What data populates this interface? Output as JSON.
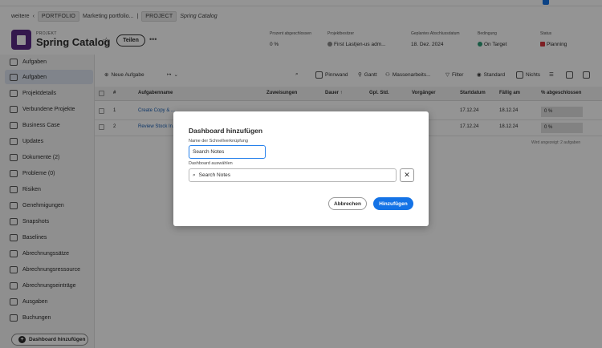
{
  "breadcrumb": {
    "back": "weitere",
    "portfolio_type": "PORTFOLIO",
    "portfolio_name": "Marketing portfolio...",
    "sep": "|",
    "project_type": "PROJECT",
    "project_name": "Spring Catalog"
  },
  "header": {
    "type_label": "PROJEKT",
    "title": "Spring Catalog",
    "share_label": "Teilen",
    "more_label": "•••",
    "meta": [
      {
        "label": "Prozent abgeschlossen",
        "value": "0 %"
      },
      {
        "label": "Projektbesitzer",
        "value": "First Last|en-us adm..."
      },
      {
        "label": "Geplantes Abschlussdatum",
        "value": "18. Dez. 2024"
      },
      {
        "label": "Bedingung",
        "value": "On Target"
      },
      {
        "label": "Status",
        "value": "Planning"
      }
    ],
    "condition_color": "#2d9d78",
    "status_color": "#d7373f"
  },
  "sidebar": {
    "items": [
      {
        "label": "Aufgaben",
        "icon": "back-arrow-icon"
      },
      {
        "label": "Aufgaben",
        "icon": "tasks-icon"
      },
      {
        "label": "Projektdetails",
        "icon": "document-icon"
      },
      {
        "label": "Verbundene Projekte",
        "icon": "link-icon"
      },
      {
        "label": "Business Case",
        "icon": "briefcase-icon"
      },
      {
        "label": "Updates",
        "icon": "chat-icon"
      },
      {
        "label": "Dokumente (2)",
        "icon": "file-icon"
      },
      {
        "label": "Probleme (0)",
        "icon": "issue-icon"
      },
      {
        "label": "Risiken",
        "icon": "risk-icon"
      },
      {
        "label": "Genehmigungen",
        "icon": "approval-icon"
      },
      {
        "label": "Snapshots",
        "icon": "camera-icon"
      },
      {
        "label": "Baselines",
        "icon": "baseline-icon"
      },
      {
        "label": "Abrechnungssätze",
        "icon": "rate-icon"
      },
      {
        "label": "Abrechnungsressource",
        "icon": "billing-icon"
      },
      {
        "label": "Abrechnungseinträge",
        "icon": "records-icon"
      },
      {
        "label": "Ausgaben",
        "icon": "expense-icon"
      },
      {
        "label": "Buchungen",
        "icon": "booking-icon"
      }
    ],
    "add_dashboard_label": "Dashboard hinzufügen"
  },
  "toolbar": {
    "new_task": "Neue Aufgabe",
    "pinwand": "Pinnwand",
    "gantt": "Gantt",
    "bulk": "Massenarbeits...",
    "filter": "Filter",
    "view": "Standard",
    "group": "Nichts"
  },
  "grid": {
    "headers": [
      "#",
      "Aufgabenname",
      "Zuweisungen",
      "Dauer ↑",
      "Gpl. Std.",
      "Vorgänger",
      "Startdatum",
      "Fällig am",
      "% abgeschlossen"
    ],
    "rows": [
      {
        "num": "1",
        "name": "Create Copy & ...",
        "start": "17.12.24",
        "due": "18.12.24",
        "pct": "0 %"
      },
      {
        "num": "2",
        "name": "Review Stock In...",
        "start": "17.12.24",
        "due": "18.12.24",
        "pct": "0 %"
      }
    ],
    "footnote": "Wird angezeigt: 2 aufgaben"
  },
  "dialog": {
    "title": "Dashboard hinzufügen",
    "name_label": "Name der Schnellverknüpfung",
    "name_value": "Search Notes",
    "dashboard_label": "Dashboard auswählen",
    "dashboard_value": "Search Notes",
    "clear_label": "✕",
    "cancel_label": "Abbrechen",
    "add_label": "Hinzufügen"
  }
}
